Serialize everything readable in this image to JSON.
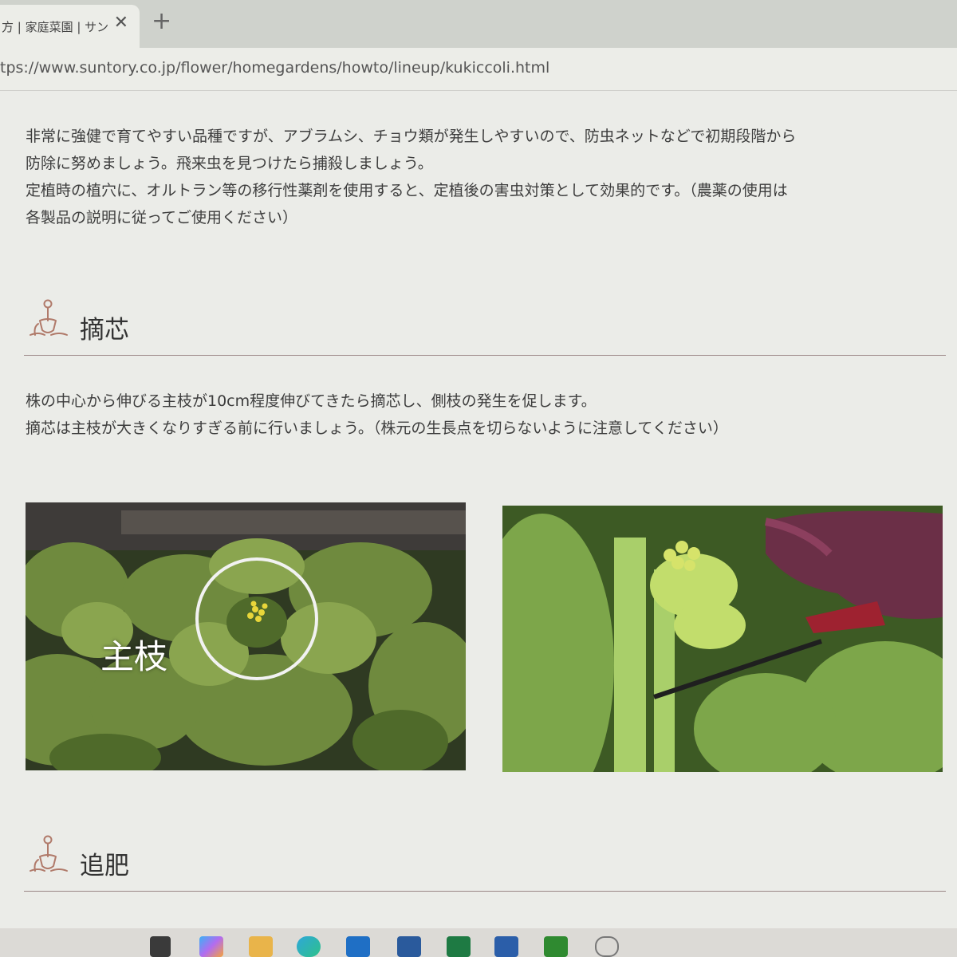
{
  "browser": {
    "tab_title": "方 | 家庭菜園 | サン",
    "tab_close": "✕",
    "new_tab": "+",
    "url": "tps://www.suntory.co.jp/flower/homegardens/howto/lineup/kukiccoli.html"
  },
  "pest_section": {
    "lines": [
      "非常に強健で育てやすい品種ですが、アブラムシ、チョウ類が発生しやすいので、防虫ネットなどで初期段階から",
      "防除に努めましょう。飛来虫を見つけたら捕殺しましょう。",
      "定植時の植穴に、オルトラン等の移行性薬剤を使用すると、定植後の害虫対策として効果的です。（農薬の使用は",
      "各製品の説明に従ってご使用ください）"
    ]
  },
  "pinching_section": {
    "title": "摘芯",
    "lines": [
      "株の中心から伸びる主枝が10cm程度伸びてきたら摘芯し、側枝の発生を促します。",
      "摘芯は主枝が大きくなりすぎる前に行いましょう。（株元の生長点を切らないように注意してください）"
    ],
    "photo_left_label": "主枝"
  },
  "fertilizer_section": {
    "title": "追肥"
  },
  "taskbar": {
    "icons": [
      "file-explorer-icon",
      "copilot-icon",
      "folder-icon",
      "edge-icon",
      "outlook-icon",
      "solitaire-icon",
      "excel-icon",
      "word-icon",
      "app-icon",
      "ime-icon"
    ]
  },
  "colors": {
    "page_bg": "#ebece8",
    "divider": "#9b8686",
    "icon_stroke": "#b07a6a"
  }
}
